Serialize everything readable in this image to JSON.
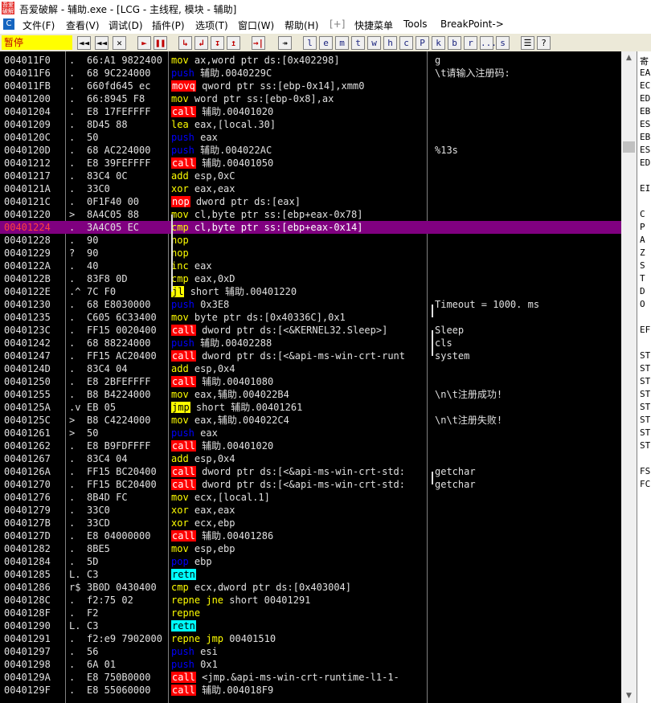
{
  "window": {
    "title": "吾爱破解 - 辅助.exe - [LCG - 主线程, 模块 - 辅助]",
    "app_icon_text": "吾爱破解"
  },
  "menu": {
    "items": [
      "文件(F)",
      "查看(V)",
      "调试(D)",
      "插件(P)",
      "选项(T)",
      "窗口(W)",
      "帮助(H)",
      "[+]",
      "快捷菜单",
      "Tools",
      "BreakPoint->"
    ]
  },
  "toolbar": {
    "status": "暂停",
    "buttons": [
      "◄◄",
      "✕",
      "►",
      "❚❚",
      "↳",
      "↲",
      "↧",
      "↥",
      "→|",
      "↠",
      "l",
      "e",
      "m",
      "t",
      "w",
      "h",
      "c",
      "P",
      "k",
      "b",
      "r",
      "...",
      "s",
      "☰",
      "?"
    ]
  },
  "colors": {
    "selected_row": "#800080",
    "call_bg": "#ff0000",
    "jmp_bg": "#ffff00",
    "retn_bg": "#00ffff",
    "push_fg": "#0000ff",
    "mnemonic_fg": "#ffff00"
  },
  "rows": [
    {
      "addr": "004011F0",
      "mark": ".",
      "hex": "66:A1 9822400",
      "mn": "mov",
      "cls": "mn",
      "ops": "ax,word ptr ds:[0x402298]",
      "cmt": "g"
    },
    {
      "addr": "004011F6",
      "mark": ".",
      "hex": "68 9C224000",
      "mn": "push",
      "cls": "mn push",
      "ops": "辅助.0040229C",
      "cmt": "\\t请输入注册码:"
    },
    {
      "addr": "004011FB",
      "mark": ".",
      "hex": "660fd645 ec",
      "mn": "movq",
      "cls": "m movq",
      "ops": "qword ptr ss:[ebp-0x14],xmm0",
      "cmt": ""
    },
    {
      "addr": "00401200",
      "mark": ".",
      "hex": "66:8945 F8",
      "mn": "mov",
      "cls": "mn",
      "ops": "word ptr ss:[ebp-0x8],ax",
      "cmt": ""
    },
    {
      "addr": "00401204",
      "mark": ".",
      "hex": "E8 17FEFFFF",
      "mn": "call",
      "cls": "m call",
      "ops": "辅助.00401020",
      "cmt": ""
    },
    {
      "addr": "00401209",
      "mark": ".",
      "hex": "8D45 88",
      "mn": "lea",
      "cls": "mn",
      "ops": "eax,[local.30]",
      "cmt": ""
    },
    {
      "addr": "0040120C",
      "mark": ".",
      "hex": "50",
      "mn": "push",
      "cls": "mn push",
      "ops": "eax",
      "cmt": ""
    },
    {
      "addr": "0040120D",
      "mark": ".",
      "hex": "68 AC224000",
      "mn": "push",
      "cls": "mn push",
      "ops": "辅助.004022AC",
      "cmt": "%13s"
    },
    {
      "addr": "00401212",
      "mark": ".",
      "hex": "E8 39FEFFFF",
      "mn": "call",
      "cls": "m call",
      "ops": "辅助.00401050",
      "cmt": ""
    },
    {
      "addr": "00401217",
      "mark": ".",
      "hex": "83C4 0C",
      "mn": "add",
      "cls": "mn",
      "ops": "esp,0xC",
      "cmt": ""
    },
    {
      "addr": "0040121A",
      "mark": ".",
      "hex": "33C0",
      "mn": "xor",
      "cls": "mn",
      "ops": "eax,eax",
      "cmt": ""
    },
    {
      "addr": "0040121C",
      "mark": ".",
      "hex": "0F1F40 00",
      "mn": "nop",
      "cls": "m nop",
      "ops": "dword ptr ds:[eax]",
      "cmt": ""
    },
    {
      "addr": "00401220",
      "mark": ">",
      "hex": "8A4C05 88",
      "mn": "mov",
      "cls": "mn",
      "ops": "cl,byte ptr ss:[ebp+eax-0x78]",
      "cmt": ""
    },
    {
      "addr": "00401224",
      "mark": ".",
      "hex": "3A4C05 EC",
      "mn": "cmp",
      "cls": "mn",
      "ops": "cl,byte ptr ss:[ebp+eax-0x14]",
      "cmt": "",
      "sel": true
    },
    {
      "addr": "00401228",
      "mark": ".",
      "hex": "90",
      "mn": "nop",
      "cls": "mn",
      "ops": "",
      "cmt": ""
    },
    {
      "addr": "00401229",
      "mark": "?",
      "hex": "90",
      "mn": "nop",
      "cls": "mn",
      "ops": "",
      "cmt": ""
    },
    {
      "addr": "0040122A",
      "mark": ".",
      "hex": "40",
      "mn": "inc",
      "cls": "mn",
      "ops": "eax",
      "cmt": ""
    },
    {
      "addr": "0040122B",
      "mark": ".",
      "hex": "83F8 0D",
      "mn": "cmp",
      "cls": "mn",
      "ops": "eax,0xD",
      "cmt": ""
    },
    {
      "addr": "0040122E",
      "mark": ".^",
      "hex": "7C F0",
      "mn": "jl",
      "cls": "m jmp",
      "ops": "short 辅助.00401220",
      "cmt": ""
    },
    {
      "addr": "00401230",
      "mark": ".",
      "hex": "68 E8030000",
      "mn": "push",
      "cls": "mn push",
      "ops": "0x3E8",
      "cmt": "Timeout = 1000. ms"
    },
    {
      "addr": "00401235",
      "mark": ".",
      "hex": "C605 6C33400",
      "mn": "mov",
      "cls": "mn",
      "ops": "byte ptr ds:[0x40336C],0x1",
      "cmt": ""
    },
    {
      "addr": "0040123C",
      "mark": ".",
      "hex": "FF15 0020400",
      "mn": "call",
      "cls": "m call",
      "ops": "dword ptr ds:[<&KERNEL32.Sleep>]",
      "cmt": "Sleep"
    },
    {
      "addr": "00401242",
      "mark": ".",
      "hex": "68 88224000",
      "mn": "push",
      "cls": "mn push",
      "ops": "辅助.00402288",
      "cmt": "cls"
    },
    {
      "addr": "00401247",
      "mark": ".",
      "hex": "FF15 AC20400",
      "mn": "call",
      "cls": "m call",
      "ops": "dword ptr ds:[<&api-ms-win-crt-runt",
      "cmt": "system"
    },
    {
      "addr": "0040124D",
      "mark": ".",
      "hex": "83C4 04",
      "mn": "add",
      "cls": "mn",
      "ops": "esp,0x4",
      "cmt": ""
    },
    {
      "addr": "00401250",
      "mark": ".",
      "hex": "E8 2BFEFFFF",
      "mn": "call",
      "cls": "m call",
      "ops": "辅助.00401080",
      "cmt": ""
    },
    {
      "addr": "00401255",
      "mark": ".",
      "hex": "B8 B4224000",
      "mn": "mov",
      "cls": "mn",
      "ops": "eax,辅助.004022B4",
      "cmt": "\\n\\t注册成功!"
    },
    {
      "addr": "0040125A",
      "mark": ".v",
      "hex": "EB 05",
      "mn": "jmp",
      "cls": "m jmp",
      "ops": "short 辅助.00401261",
      "cmt": ""
    },
    {
      "addr": "0040125C",
      "mark": ">",
      "hex": "B8 C4224000",
      "mn": "mov",
      "cls": "mn",
      "ops": "eax,辅助.004022C4",
      "cmt": "\\n\\t注册失败!"
    },
    {
      "addr": "00401261",
      "mark": ">",
      "hex": "50",
      "mn": "push",
      "cls": "mn push",
      "ops": "eax",
      "cmt": ""
    },
    {
      "addr": "00401262",
      "mark": ".",
      "hex": "E8 B9FDFFFF",
      "mn": "call",
      "cls": "m call",
      "ops": "辅助.00401020",
      "cmt": ""
    },
    {
      "addr": "00401267",
      "mark": ".",
      "hex": "83C4 04",
      "mn": "add",
      "cls": "mn",
      "ops": "esp,0x4",
      "cmt": ""
    },
    {
      "addr": "0040126A",
      "mark": ".",
      "hex": "FF15 BC20400",
      "mn": "call",
      "cls": "m call",
      "ops": "dword ptr ds:[<&api-ms-win-crt-std:",
      "cmt": "getchar"
    },
    {
      "addr": "00401270",
      "mark": ".",
      "hex": "FF15 BC20400",
      "mn": "call",
      "cls": "m call",
      "ops": "dword ptr ds:[<&api-ms-win-crt-std:",
      "cmt": "getchar"
    },
    {
      "addr": "00401276",
      "mark": ".",
      "hex": "8B4D FC",
      "mn": "mov",
      "cls": "mn",
      "ops": "ecx,[local.1]",
      "cmt": ""
    },
    {
      "addr": "00401279",
      "mark": ".",
      "hex": "33C0",
      "mn": "xor",
      "cls": "mn",
      "ops": "eax,eax",
      "cmt": ""
    },
    {
      "addr": "0040127B",
      "mark": ".",
      "hex": "33CD",
      "mn": "xor",
      "cls": "mn",
      "ops": "ecx,ebp",
      "cmt": ""
    },
    {
      "addr": "0040127D",
      "mark": ".",
      "hex": "E8 04000000",
      "mn": "call",
      "cls": "m call",
      "ops": "辅助.00401286",
      "cmt": ""
    },
    {
      "addr": "00401282",
      "mark": ".",
      "hex": "8BE5",
      "mn": "mov",
      "cls": "mn",
      "ops": "esp,ebp",
      "cmt": ""
    },
    {
      "addr": "00401284",
      "mark": ".",
      "hex": "5D",
      "mn": "pop",
      "cls": "mn push",
      "ops": "ebp",
      "cmt": ""
    },
    {
      "addr": "00401285",
      "mark": "L.",
      "hex": "C3",
      "mn": "retn",
      "cls": "m retn",
      "ops": "",
      "cmt": ""
    },
    {
      "addr": "00401286",
      "mark": "r$",
      "hex": "3B0D 0430400",
      "mn": "cmp",
      "cls": "mn",
      "ops": "ecx,dword ptr ds:[0x403004]",
      "cmt": ""
    },
    {
      "addr": "0040128C",
      "mark": ".",
      "hex": "f2:75 02",
      "mn": "repne jne",
      "cls": "mn",
      "ops": "short 00401291",
      "cmt": ""
    },
    {
      "addr": "0040128F",
      "mark": ".",
      "hex": "F2",
      "mn": "repne",
      "cls": "mn",
      "ops": "",
      "cmt": ""
    },
    {
      "addr": "00401290",
      "mark": "L.",
      "hex": "C3",
      "mn": "retn",
      "cls": "m retn",
      "ops": "",
      "cmt": ""
    },
    {
      "addr": "00401291",
      "mark": ".",
      "hex": "f2:e9 7902000",
      "mn": "repne jmp",
      "cls": "mn",
      "ops": "00401510",
      "cmt": ""
    },
    {
      "addr": "00401297",
      "mark": ".",
      "hex": "56",
      "mn": "push",
      "cls": "mn push",
      "ops": "esi",
      "cmt": ""
    },
    {
      "addr": "00401298",
      "mark": ".",
      "hex": "6A 01",
      "mn": "push",
      "cls": "mn push",
      "ops": "0x1",
      "cmt": ""
    },
    {
      "addr": "0040129A",
      "mark": ".",
      "hex": "E8 750B0000",
      "mn": "call",
      "cls": "m call",
      "ops": "<jmp.&api-ms-win-crt-runtime-l1-1-",
      "cmt": ""
    },
    {
      "addr": "0040129F",
      "mark": ".",
      "hex": "E8 55060000",
      "mn": "call",
      "cls": "m call",
      "ops": "辅助.004018F9",
      "cmt": ""
    }
  ],
  "registers": [
    "寄",
    "EA",
    "EC",
    "ED",
    "EB",
    "ES",
    "EB",
    "ES",
    "ED",
    "",
    "EI",
    "",
    "C",
    "P",
    "A",
    "Z",
    "S",
    "T",
    "D",
    "O",
    "",
    "EF",
    "",
    "ST",
    "ST",
    "ST",
    "ST",
    "ST",
    "ST",
    "ST",
    "ST",
    "",
    "FS",
    "FC"
  ]
}
